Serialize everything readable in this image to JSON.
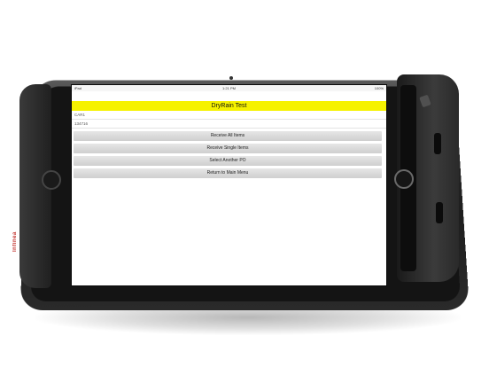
{
  "status_bar": {
    "carrier": "iPad",
    "time": "1:21 PM",
    "battery": "100%"
  },
  "app": {
    "title": "DryRain Test",
    "info_lines": [
      "CAR1",
      "134716"
    ]
  },
  "menu": {
    "buttons": [
      {
        "label": "Receive All Items"
      },
      {
        "label": "Receive Single Items"
      },
      {
        "label": "Select Another PO"
      },
      {
        "label": "Return to Main Menu"
      }
    ]
  },
  "device": {
    "brand_label": "Infinea",
    "title_bar_color": "#f6f200"
  }
}
